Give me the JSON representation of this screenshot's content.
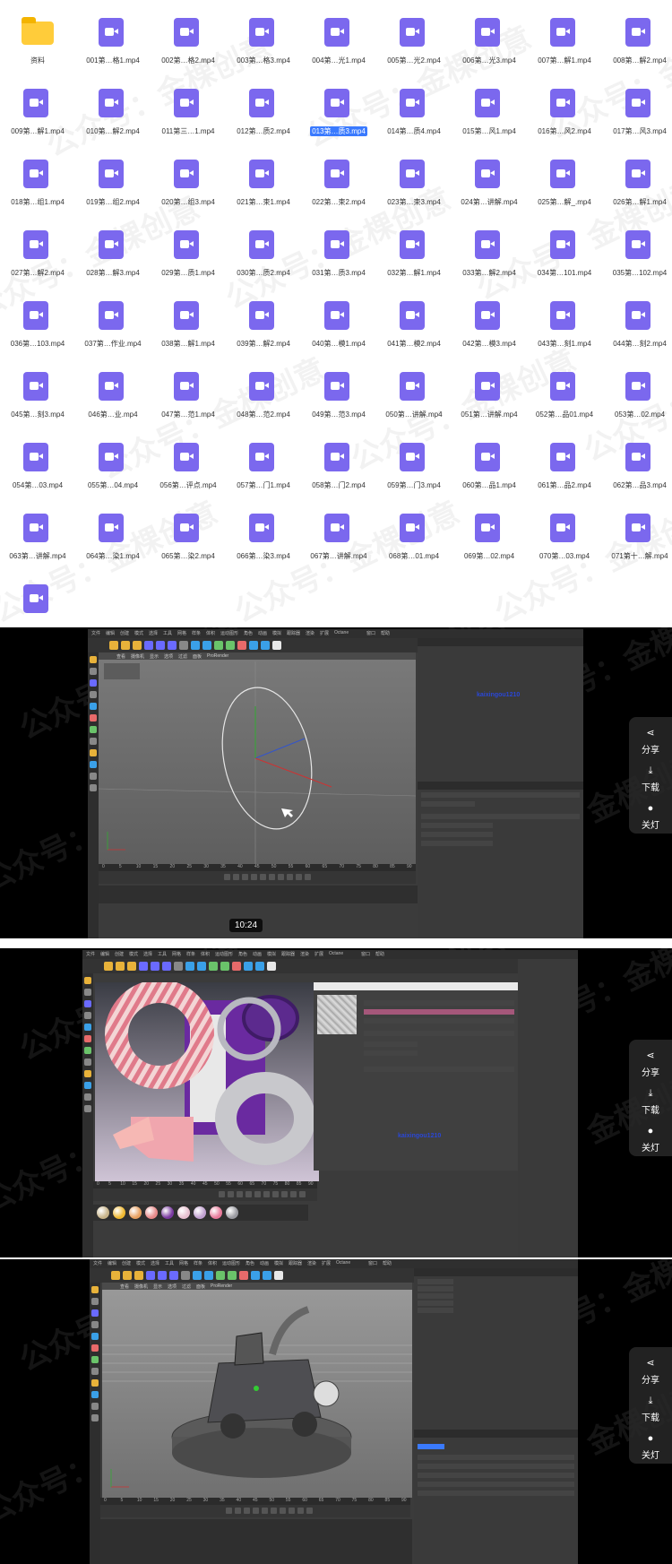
{
  "files": [
    {
      "name": "资料",
      "type": "folder"
    },
    {
      "name": "001第…格1.mp4",
      "type": "video"
    },
    {
      "name": "002第…格2.mp4",
      "type": "video"
    },
    {
      "name": "003第…格3.mp4",
      "type": "video"
    },
    {
      "name": "004第…光1.mp4",
      "type": "video"
    },
    {
      "name": "005第…光2.mp4",
      "type": "video"
    },
    {
      "name": "006第…光3.mp4",
      "type": "video"
    },
    {
      "name": "007第…解1.mp4",
      "type": "video"
    },
    {
      "name": "008第…解2.mp4",
      "type": "video"
    },
    {
      "name": "009第…解1.mp4",
      "type": "video"
    },
    {
      "name": "010第…解2.mp4",
      "type": "video"
    },
    {
      "name": "011第三…1.mp4",
      "type": "video"
    },
    {
      "name": "012第…质2.mp4",
      "type": "video"
    },
    {
      "name": "013第…质3.mp4",
      "type": "video",
      "selected": true
    },
    {
      "name": "014第…质4.mp4",
      "type": "video"
    },
    {
      "name": "015第…风1.mp4",
      "type": "video"
    },
    {
      "name": "016第…风2.mp4",
      "type": "video"
    },
    {
      "name": "017第…风3.mp4",
      "type": "video"
    },
    {
      "name": "018第…组1.mp4",
      "type": "video"
    },
    {
      "name": "019第…组2.mp4",
      "type": "video"
    },
    {
      "name": "020第…组3.mp4",
      "type": "video"
    },
    {
      "name": "021第…束1.mp4",
      "type": "video"
    },
    {
      "name": "022第…束2.mp4",
      "type": "video"
    },
    {
      "name": "023第…束3.mp4",
      "type": "video"
    },
    {
      "name": "024第…讲解.mp4",
      "type": "video"
    },
    {
      "name": "025第…解_.mp4",
      "type": "video"
    },
    {
      "name": "026第…解1.mp4",
      "type": "video"
    },
    {
      "name": "027第…解2.mp4",
      "type": "video"
    },
    {
      "name": "028第…解3.mp4",
      "type": "video"
    },
    {
      "name": "029第…质1.mp4",
      "type": "video"
    },
    {
      "name": "030第…质2.mp4",
      "type": "video"
    },
    {
      "name": "031第…质3.mp4",
      "type": "video"
    },
    {
      "name": "032第…解1.mp4",
      "type": "video"
    },
    {
      "name": "033第…解2.mp4",
      "type": "video"
    },
    {
      "name": "034第…101.mp4",
      "type": "video"
    },
    {
      "name": "035第…102.mp4",
      "type": "video"
    },
    {
      "name": "036第…103.mp4",
      "type": "video"
    },
    {
      "name": "037第…作业.mp4",
      "type": "video"
    },
    {
      "name": "038第…解1.mp4",
      "type": "video"
    },
    {
      "name": "039第…解2.mp4",
      "type": "video"
    },
    {
      "name": "040第…模1.mp4",
      "type": "video"
    },
    {
      "name": "041第…模2.mp4",
      "type": "video"
    },
    {
      "name": "042第…模3.mp4",
      "type": "video"
    },
    {
      "name": "043第…刻1.mp4",
      "type": "video"
    },
    {
      "name": "044第…刻2.mp4",
      "type": "video"
    },
    {
      "name": "045第…刻3.mp4",
      "type": "video"
    },
    {
      "name": "046第…业.mp4",
      "type": "video"
    },
    {
      "name": "047第…范1.mp4",
      "type": "video"
    },
    {
      "name": "048第…范2.mp4",
      "type": "video"
    },
    {
      "name": "049第…范3.mp4",
      "type": "video"
    },
    {
      "name": "050第…讲解.mp4",
      "type": "video"
    },
    {
      "name": "051第…讲解.mp4",
      "type": "video"
    },
    {
      "name": "052第…品01.mp4",
      "type": "video"
    },
    {
      "name": "053第…02.mp4",
      "type": "video"
    },
    {
      "name": "054第…03.mp4",
      "type": "video"
    },
    {
      "name": "055第…04.mp4",
      "type": "video"
    },
    {
      "name": "056第…评点.mp4",
      "type": "video"
    },
    {
      "name": "057第…门1.mp4",
      "type": "video"
    },
    {
      "name": "058第…门2.mp4",
      "type": "video"
    },
    {
      "name": "059第…门3.mp4",
      "type": "video"
    },
    {
      "name": "060第…品1.mp4",
      "type": "video"
    },
    {
      "name": "061第…品2.mp4",
      "type": "video"
    },
    {
      "name": "062第…品3.mp4",
      "type": "video"
    },
    {
      "name": "063第…讲解.mp4",
      "type": "video"
    },
    {
      "name": "064第…染1.mp4",
      "type": "video"
    },
    {
      "name": "065第…染2.mp4",
      "type": "video"
    },
    {
      "name": "066第…染3.mp4",
      "type": "video"
    },
    {
      "name": "067第…讲解.mp4",
      "type": "video"
    },
    {
      "name": "068第…01.mp4",
      "type": "video"
    },
    {
      "name": "069第…02.mp4",
      "type": "video"
    },
    {
      "name": "070第…03.mp4",
      "type": "video"
    },
    {
      "name": "071第十…解.mp4",
      "type": "video"
    },
    {
      "name": "",
      "type": "video"
    }
  ],
  "watermark_text": "公众号：金棵创意",
  "videos": [
    {
      "time": "10:24",
      "blue_label": "kaixingou1210"
    },
    {
      "blue_label": "kaixingou1210"
    },
    {}
  ],
  "side_controls": {
    "share": "分享",
    "download": "下载",
    "close": "关灯"
  },
  "c4d_menu": [
    "文件",
    "编辑",
    "创建",
    "模式",
    "选择",
    "工具",
    "网格",
    "样条",
    "体积",
    "运动图形",
    "角色",
    "动画",
    "模拟",
    "跟踪器",
    "渲染",
    "扩展",
    "Octane",
    "窗口",
    "帮助"
  ],
  "viewport_menu": [
    "查看",
    "摄像机",
    "显示",
    "选项",
    "过滤",
    "面板",
    "ProRender"
  ],
  "timeline_ticks": [
    "0",
    "5",
    "10",
    "15",
    "20",
    "25",
    "30",
    "35",
    "40",
    "45",
    "50",
    "55",
    "60",
    "65",
    "70",
    "75",
    "80",
    "85",
    "90"
  ],
  "colors": {
    "video_icon": "#7b68ee",
    "folder": "#ffcc3a",
    "selection": "#3a7afe",
    "c4d_bg": "#3b3b3b"
  }
}
